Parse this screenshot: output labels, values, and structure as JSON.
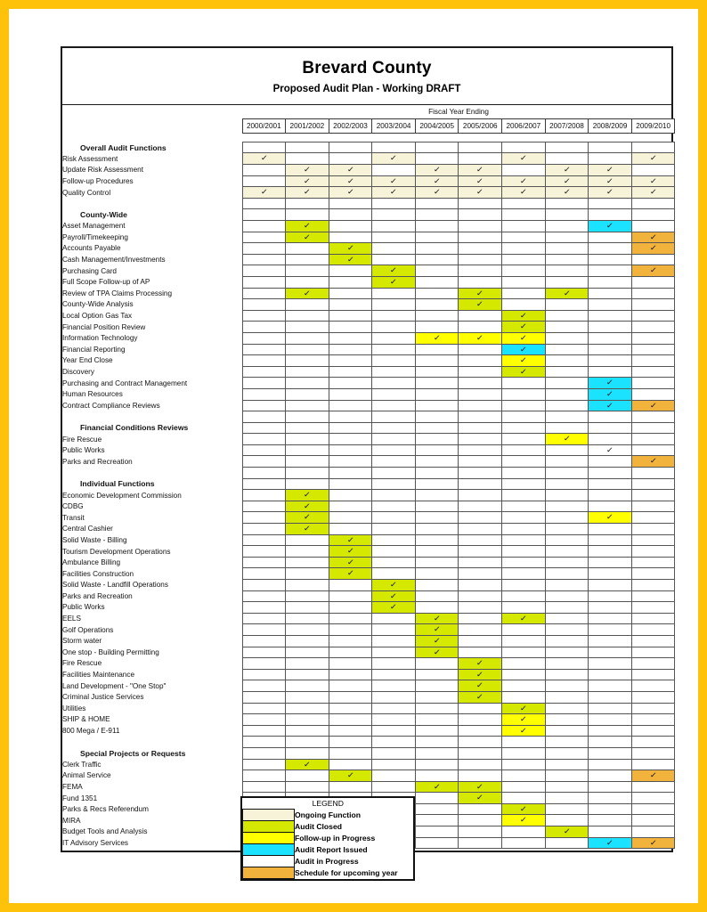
{
  "header": {
    "title": "Brevard County",
    "subtitle": "Proposed Audit Plan - Working DRAFT",
    "fiscal_label": "Fiscal Year Ending"
  },
  "columns": [
    "2000/2001",
    "2001/2002",
    "2002/2003",
    "2003/2004",
    "2004/2005",
    "2005/2006",
    "2006/2007",
    "2007/2008",
    "2008/2009",
    "2009/2010"
  ],
  "check_glyph": "✓",
  "colors": {
    "ongoing": "#F7F3D8",
    "closed": "#D4E800",
    "followup": "#FFFF00",
    "report_issued": "#1BE3FF",
    "in_progress": "#FFFFFF",
    "scheduled": "#F2B33D",
    "page_border": "#FFC20A"
  },
  "legend": {
    "title": "LEGEND",
    "items": [
      {
        "label": "Ongoing Function",
        "fill": "cream"
      },
      {
        "label": "Audit Closed",
        "fill": "green"
      },
      {
        "label": "Follow-up in Progress",
        "fill": "yellow"
      },
      {
        "label": "Audit Report Issued",
        "fill": "cyan"
      },
      {
        "label": "Audit in Progress",
        "fill": "white"
      },
      {
        "label": "Schedule for upcoming year",
        "fill": "orange"
      }
    ]
  },
  "rows": [
    {
      "type": "section",
      "label": "Overall Audit Functions",
      "cells": [
        "",
        "",
        "",
        "",
        "",
        "",
        "",
        "",
        "",
        ""
      ]
    },
    {
      "type": "item",
      "label": "Risk Assessment",
      "cells": [
        "cream",
        "",
        "",
        "cream",
        "",
        "",
        "cream",
        "",
        "",
        "cream"
      ]
    },
    {
      "type": "item",
      "label": "Update Risk Assessment",
      "cells": [
        "",
        "cream",
        "cream",
        "",
        "cream",
        "cream",
        "",
        "cream",
        "cream",
        ""
      ]
    },
    {
      "type": "item",
      "label": "Follow-up Procedures",
      "cells": [
        "",
        "cream",
        "cream",
        "cream",
        "cream",
        "cream",
        "cream",
        "cream",
        "cream",
        "cream"
      ]
    },
    {
      "type": "item",
      "label": "Quality Control",
      "cells": [
        "cream",
        "cream",
        "cream",
        "cream",
        "cream",
        "cream",
        "cream",
        "cream",
        "cream",
        "cream"
      ]
    },
    {
      "type": "blank",
      "label": "",
      "cells": [
        "",
        "",
        "",
        "",
        "",
        "",
        "",
        "",
        "",
        ""
      ]
    },
    {
      "type": "section",
      "label": "County-Wide",
      "cells": [
        "",
        "",
        "",
        "",
        "",
        "",
        "",
        "",
        "",
        ""
      ]
    },
    {
      "type": "item",
      "label": "Asset Management",
      "cells": [
        "",
        "green",
        "",
        "",
        "",
        "",
        "",
        "",
        "cyan",
        ""
      ]
    },
    {
      "type": "item",
      "label": "Payroll/Timekeeping",
      "cells": [
        "",
        "green",
        "",
        "",
        "",
        "",
        "",
        "",
        "",
        "orange"
      ]
    },
    {
      "type": "item",
      "label": "Accounts Payable",
      "cells": [
        "",
        "",
        "green",
        "",
        "",
        "",
        "",
        "",
        "",
        "orange"
      ]
    },
    {
      "type": "item",
      "label": "Cash Management/Investments",
      "cells": [
        "",
        "",
        "green",
        "",
        "",
        "",
        "",
        "",
        "",
        ""
      ]
    },
    {
      "type": "item",
      "label": "Purchasing Card",
      "cells": [
        "",
        "",
        "",
        "green",
        "",
        "",
        "",
        "",
        "",
        "orange"
      ]
    },
    {
      "type": "item",
      "label": "Full Scope Follow-up of AP",
      "cells": [
        "",
        "",
        "",
        "green",
        "",
        "",
        "",
        "",
        "",
        ""
      ]
    },
    {
      "type": "item",
      "label": "Review of TPA Claims Processing",
      "cells": [
        "",
        "green",
        "",
        "",
        "",
        "green",
        "",
        "green",
        "",
        ""
      ]
    },
    {
      "type": "item",
      "label": "County-Wide Analysis",
      "cells": [
        "",
        "",
        "",
        "",
        "",
        "green",
        "",
        "",
        "",
        ""
      ]
    },
    {
      "type": "item",
      "label": "Local Option Gas Tax",
      "cells": [
        "",
        "",
        "",
        "",
        "",
        "",
        "green",
        "",
        "",
        ""
      ]
    },
    {
      "type": "item",
      "label": "Financial Position Review",
      "cells": [
        "",
        "",
        "",
        "",
        "",
        "",
        "green",
        "",
        "",
        ""
      ]
    },
    {
      "type": "item",
      "label": "Information Technology",
      "cells": [
        "",
        "",
        "",
        "",
        "yellow",
        "yellow",
        "yellow",
        "",
        "",
        ""
      ]
    },
    {
      "type": "item",
      "label": "Financial Reporting",
      "cells": [
        "",
        "",
        "",
        "",
        "",
        "",
        "cyan",
        "",
        "",
        ""
      ]
    },
    {
      "type": "item",
      "label": "Year End Close",
      "cells": [
        "",
        "",
        "",
        "",
        "",
        "",
        "yellow",
        "",
        "",
        ""
      ]
    },
    {
      "type": "item",
      "label": "Discovery",
      "cells": [
        "",
        "",
        "",
        "",
        "",
        "",
        "green",
        "",
        "",
        ""
      ]
    },
    {
      "type": "item",
      "label": "Purchasing and Contract Management",
      "cells": [
        "",
        "",
        "",
        "",
        "",
        "",
        "",
        "",
        "cyan",
        ""
      ]
    },
    {
      "type": "item",
      "label": "Human Resources",
      "cells": [
        "",
        "",
        "",
        "",
        "",
        "",
        "",
        "",
        "cyan",
        ""
      ]
    },
    {
      "type": "item",
      "label": "Contract Compliance Reviews",
      "cells": [
        "",
        "",
        "",
        "",
        "",
        "",
        "",
        "",
        "cyan",
        "orange"
      ]
    },
    {
      "type": "blank",
      "label": "",
      "cells": [
        "",
        "",
        "",
        "",
        "",
        "",
        "",
        "",
        "",
        ""
      ]
    },
    {
      "type": "section",
      "label": "Financial Conditions Reviews",
      "cells": [
        "",
        "",
        "",
        "",
        "",
        "",
        "",
        "",
        "",
        ""
      ]
    },
    {
      "type": "item",
      "label": "Fire Rescue",
      "cells": [
        "",
        "",
        "",
        "",
        "",
        "",
        "",
        "yellow",
        "",
        ""
      ]
    },
    {
      "type": "item",
      "label": "Public Works",
      "cells": [
        "",
        "",
        "",
        "",
        "",
        "",
        "",
        "",
        "white",
        ""
      ]
    },
    {
      "type": "item",
      "label": "Parks and Recreation",
      "cells": [
        "",
        "",
        "",
        "",
        "",
        "",
        "",
        "",
        "",
        "orange"
      ]
    },
    {
      "type": "blank",
      "label": "",
      "cells": [
        "",
        "",
        "",
        "",
        "",
        "",
        "",
        "",
        "",
        ""
      ]
    },
    {
      "type": "section",
      "label": "Individual Functions",
      "cells": [
        "",
        "",
        "",
        "",
        "",
        "",
        "",
        "",
        "",
        ""
      ]
    },
    {
      "type": "item",
      "label": "Economic Development Commission",
      "cells": [
        "",
        "green",
        "",
        "",
        "",
        "",
        "",
        "",
        "",
        ""
      ]
    },
    {
      "type": "item",
      "label": "CDBG",
      "cells": [
        "",
        "green",
        "",
        "",
        "",
        "",
        "",
        "",
        "",
        ""
      ]
    },
    {
      "type": "item",
      "label": "Transit",
      "cells": [
        "",
        "green",
        "",
        "",
        "",
        "",
        "",
        "",
        "yellow",
        ""
      ]
    },
    {
      "type": "item",
      "label": "Central Cashier",
      "cells": [
        "",
        "green",
        "",
        "",
        "",
        "",
        "",
        "",
        "",
        ""
      ]
    },
    {
      "type": "item",
      "label": "Solid Waste - Billing",
      "cells": [
        "",
        "",
        "green",
        "",
        "",
        "",
        "",
        "",
        "",
        ""
      ]
    },
    {
      "type": "item",
      "label": "Tourism Development Operations",
      "cells": [
        "",
        "",
        "green",
        "",
        "",
        "",
        "",
        "",
        "",
        ""
      ]
    },
    {
      "type": "item",
      "label": "Ambulance Billing",
      "cells": [
        "",
        "",
        "green",
        "",
        "",
        "",
        "",
        "",
        "",
        ""
      ]
    },
    {
      "type": "item",
      "label": "Facilities Construction",
      "cells": [
        "",
        "",
        "green",
        "",
        "",
        "",
        "",
        "",
        "",
        ""
      ]
    },
    {
      "type": "item",
      "label": "Solid Waste - Landfill Operations",
      "cells": [
        "",
        "",
        "",
        "green",
        "",
        "",
        "",
        "",
        "",
        ""
      ]
    },
    {
      "type": "item",
      "label": "Parks and Recreation",
      "cells": [
        "",
        "",
        "",
        "green",
        "",
        "",
        "",
        "",
        "",
        ""
      ]
    },
    {
      "type": "item",
      "label": "Public Works",
      "cells": [
        "",
        "",
        "",
        "green",
        "",
        "",
        "",
        "",
        "",
        ""
      ]
    },
    {
      "type": "item",
      "label": "EELS",
      "cells": [
        "",
        "",
        "",
        "",
        "green",
        "",
        "green",
        "",
        "",
        ""
      ]
    },
    {
      "type": "item",
      "label": "Golf Operations",
      "cells": [
        "",
        "",
        "",
        "",
        "green",
        "",
        "",
        "",
        "",
        ""
      ]
    },
    {
      "type": "item",
      "label": "Storm water",
      "cells": [
        "",
        "",
        "",
        "",
        "green",
        "",
        "",
        "",
        "",
        ""
      ]
    },
    {
      "type": "item",
      "label": "One stop - Building Permitting",
      "cells": [
        "",
        "",
        "",
        "",
        "green",
        "",
        "",
        "",
        "",
        ""
      ]
    },
    {
      "type": "item",
      "label": "Fire Rescue",
      "cells": [
        "",
        "",
        "",
        "",
        "",
        "green",
        "",
        "",
        "",
        ""
      ]
    },
    {
      "type": "item",
      "label": "Facilities Maintenance",
      "cells": [
        "",
        "",
        "",
        "",
        "",
        "green",
        "",
        "",
        "",
        ""
      ]
    },
    {
      "type": "item",
      "label": "Land Development - \"One Stop\"",
      "cells": [
        "",
        "",
        "",
        "",
        "",
        "green",
        "",
        "",
        "",
        ""
      ]
    },
    {
      "type": "item",
      "label": "Criminal Justice Services",
      "cells": [
        "",
        "",
        "",
        "",
        "",
        "green",
        "",
        "",
        "",
        ""
      ]
    },
    {
      "type": "item",
      "label": "Utilities",
      "cells": [
        "",
        "",
        "",
        "",
        "",
        "",
        "green",
        "",
        "",
        ""
      ]
    },
    {
      "type": "item",
      "label": "SHIP & HOME",
      "cells": [
        "",
        "",
        "",
        "",
        "",
        "",
        "yellow",
        "",
        "",
        ""
      ]
    },
    {
      "type": "item",
      "label": "800 Mega / E-911",
      "cells": [
        "",
        "",
        "",
        "",
        "",
        "",
        "yellow",
        "",
        "",
        ""
      ]
    },
    {
      "type": "blank",
      "label": "",
      "cells": [
        "",
        "",
        "",
        "",
        "",
        "",
        "",
        "",
        "",
        ""
      ]
    },
    {
      "type": "section",
      "label": "Special Projects or Requests",
      "cells": [
        "",
        "",
        "",
        "",
        "",
        "",
        "",
        "",
        "",
        ""
      ]
    },
    {
      "type": "item",
      "label": "Clerk Traffic",
      "cells": [
        "",
        "green",
        "",
        "",
        "",
        "",
        "",
        "",
        "",
        ""
      ]
    },
    {
      "type": "item",
      "label": "Animal Service",
      "cells": [
        "",
        "",
        "green",
        "",
        "",
        "",
        "",
        "",
        "",
        "orange"
      ]
    },
    {
      "type": "item",
      "label": "FEMA",
      "cells": [
        "",
        "",
        "",
        "",
        "green",
        "green",
        "",
        "",
        "",
        ""
      ]
    },
    {
      "type": "item",
      "label": "Fund 1351",
      "cells": [
        "",
        "",
        "",
        "",
        "",
        "green",
        "",
        "",
        "",
        ""
      ]
    },
    {
      "type": "item",
      "label": "Parks & Recs Referendum",
      "cells": [
        "",
        "",
        "",
        "",
        "",
        "",
        "green",
        "",
        "",
        ""
      ]
    },
    {
      "type": "item",
      "label": "MIRA",
      "cells": [
        "",
        "",
        "",
        "",
        "",
        "",
        "yellow",
        "",
        "",
        ""
      ]
    },
    {
      "type": "item",
      "label": "Budget Tools and Analysis",
      "cells": [
        "",
        "",
        "",
        "",
        "",
        "",
        "",
        "green",
        "",
        ""
      ]
    },
    {
      "type": "item",
      "label": "IT Advisory Services",
      "cells": [
        "",
        "",
        "",
        "",
        "",
        "",
        "",
        "",
        "cyan",
        "orange"
      ]
    }
  ]
}
